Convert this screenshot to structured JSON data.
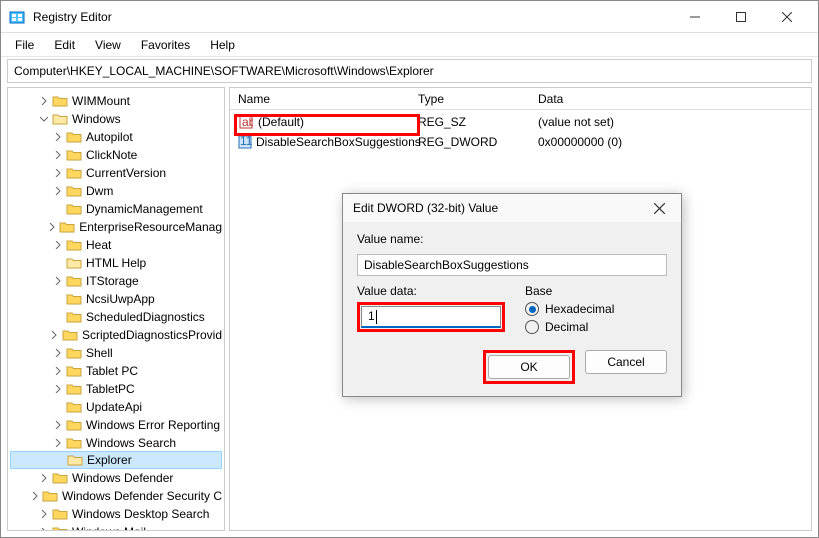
{
  "window": {
    "title": "Registry Editor",
    "minimize": "–",
    "maximize": "▢",
    "close": "✕"
  },
  "menu": {
    "file": "File",
    "edit": "Edit",
    "view": "View",
    "favorites": "Favorites",
    "help": "Help"
  },
  "address": "Computer\\HKEY_LOCAL_MACHINE\\SOFTWARE\\Microsoft\\Windows\\Explorer",
  "tree": [
    {
      "label": "WIMMount",
      "indent": 2,
      "chev": "right",
      "open": false
    },
    {
      "label": "Windows",
      "indent": 2,
      "chev": "down",
      "open": true
    },
    {
      "label": "Autopilot",
      "indent": 3,
      "chev": "right",
      "open": false
    },
    {
      "label": "ClickNote",
      "indent": 3,
      "chev": "right",
      "open": false
    },
    {
      "label": "CurrentVersion",
      "indent": 3,
      "chev": "right",
      "open": false
    },
    {
      "label": "Dwm",
      "indent": 3,
      "chev": "right",
      "open": false
    },
    {
      "label": "DynamicManagement",
      "indent": 3,
      "chev": "none",
      "open": false
    },
    {
      "label": "EnterpriseResourceManag",
      "indent": 3,
      "chev": "right",
      "open": false
    },
    {
      "label": "Heat",
      "indent": 3,
      "chev": "right",
      "open": false
    },
    {
      "label": "HTML Help",
      "indent": 3,
      "chev": "none",
      "open": true
    },
    {
      "label": "ITStorage",
      "indent": 3,
      "chev": "right",
      "open": false
    },
    {
      "label": "NcsiUwpApp",
      "indent": 3,
      "chev": "none",
      "open": false
    },
    {
      "label": "ScheduledDiagnostics",
      "indent": 3,
      "chev": "none",
      "open": false
    },
    {
      "label": "ScriptedDiagnosticsProvid",
      "indent": 3,
      "chev": "right",
      "open": false
    },
    {
      "label": "Shell",
      "indent": 3,
      "chev": "right",
      "open": false
    },
    {
      "label": "Tablet PC",
      "indent": 3,
      "chev": "right",
      "open": false
    },
    {
      "label": "TabletPC",
      "indent": 3,
      "chev": "right",
      "open": false
    },
    {
      "label": "UpdateApi",
      "indent": 3,
      "chev": "none",
      "open": false
    },
    {
      "label": "Windows Error Reporting",
      "indent": 3,
      "chev": "right",
      "open": false
    },
    {
      "label": "Windows Search",
      "indent": 3,
      "chev": "right",
      "open": false
    },
    {
      "label": "Explorer",
      "indent": 3,
      "chev": "none",
      "open": true,
      "selected": true
    },
    {
      "label": "Windows Defender",
      "indent": 2,
      "chev": "right",
      "open": false
    },
    {
      "label": "Windows Defender Security C",
      "indent": 2,
      "chev": "right",
      "open": false
    },
    {
      "label": "Windows Desktop Search",
      "indent": 2,
      "chev": "right",
      "open": false
    },
    {
      "label": "Windows Mail",
      "indent": 2,
      "chev": "right",
      "open": false
    }
  ],
  "list": {
    "headers": {
      "name": "Name",
      "type": "Type",
      "data": "Data"
    },
    "rows": [
      {
        "icon": "string",
        "name": "(Default)",
        "type": "REG_SZ",
        "data": "(value not set)"
      },
      {
        "icon": "dword",
        "name": "DisableSearchBoxSuggestions",
        "type": "REG_DWORD",
        "data": "0x00000000 (0)"
      }
    ]
  },
  "dialog": {
    "title": "Edit DWORD (32-bit) Value",
    "label_name": "Value name:",
    "value_name": "DisableSearchBoxSuggestions",
    "label_data": "Value data:",
    "value_data": "1",
    "base_label": "Base",
    "hex": "Hexadecimal",
    "dec": "Decimal",
    "ok": "OK",
    "cancel": "Cancel"
  }
}
